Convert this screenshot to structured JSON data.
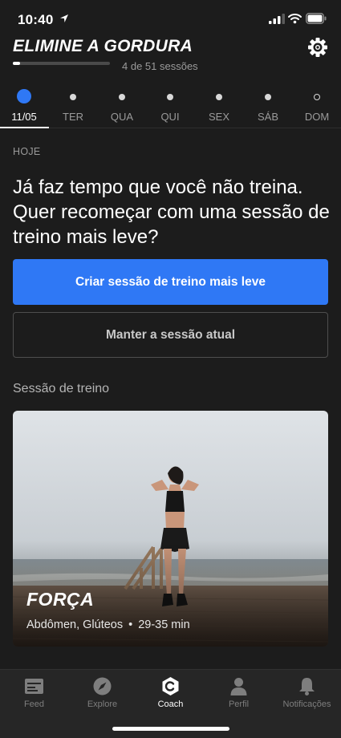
{
  "status_bar": {
    "time": "10:40"
  },
  "header": {
    "plan_title": "ELIMINE A GORDURA",
    "sessions_text": "4 de 51 sessões",
    "progress_fraction": 0.078
  },
  "days": [
    {
      "label": "11/05",
      "marker": "current",
      "active": true
    },
    {
      "label": "TER",
      "marker": "filled",
      "active": false
    },
    {
      "label": "QUA",
      "marker": "filled",
      "active": false
    },
    {
      "label": "QUI",
      "marker": "filled",
      "active": false
    },
    {
      "label": "SEX",
      "marker": "filled",
      "active": false
    },
    {
      "label": "SÁB",
      "marker": "filled",
      "active": false
    },
    {
      "label": "DOM",
      "marker": "hollow",
      "active": false
    }
  ],
  "content": {
    "today_label": "HOJE",
    "prompt": "Já faz tempo que você não treina. Quer recomeçar com uma sessão de treino mais leve?",
    "primary_button": "Criar sessão de treino mais leve",
    "secondary_button": "Manter a sessão atual",
    "section_title": "Sessão de treino"
  },
  "workout": {
    "name": "FORÇA",
    "focus": "Abdômen, Glúteos",
    "separator": "•",
    "duration": "29-35 min"
  },
  "tabs": [
    {
      "label": "Feed",
      "icon": "feed-icon",
      "active": false
    },
    {
      "label": "Explore",
      "icon": "compass-icon",
      "active": false
    },
    {
      "label": "Coach",
      "icon": "coach-icon",
      "active": true
    },
    {
      "label": "Perfil",
      "icon": "profile-icon",
      "active": false
    },
    {
      "label": "Notificações",
      "icon": "bell-icon",
      "active": false
    }
  ],
  "colors": {
    "accent": "#2f78f5",
    "background": "#1c1c1c",
    "tab_bar": "#262626"
  }
}
